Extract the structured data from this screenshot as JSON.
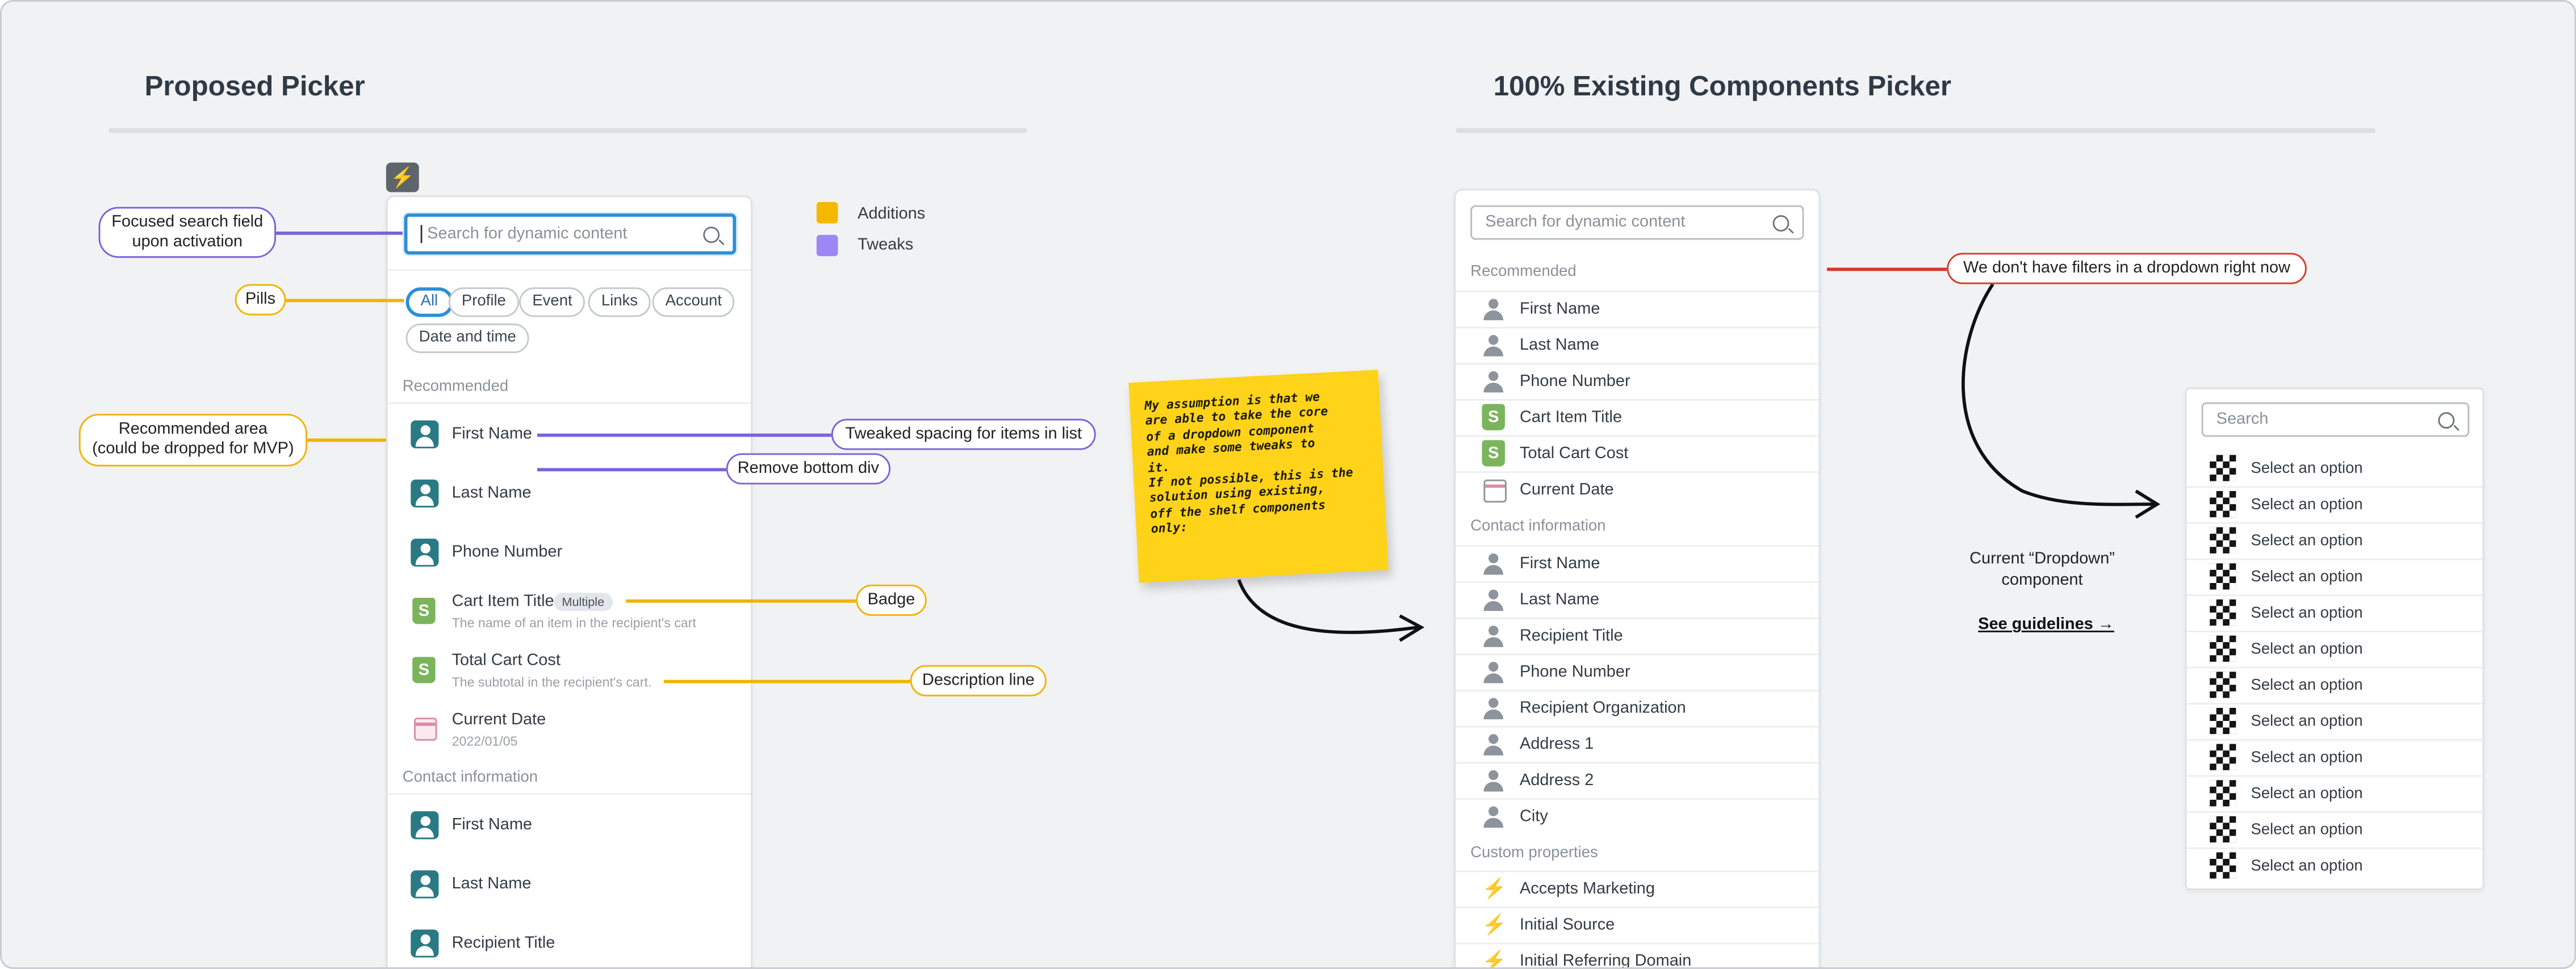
{
  "left_section": {
    "title": "Proposed Picker",
    "search_placeholder": "Search for dynamic content",
    "pills": [
      "All",
      "Profile",
      "Event",
      "Links",
      "Account",
      "Date and time"
    ],
    "groups": {
      "recommended": "Recommended",
      "contact": "Contact information"
    },
    "recommended_items": [
      {
        "label": "First Name",
        "icon": "person-avatar-icon"
      },
      {
        "label": "Last Name",
        "icon": "person-avatar-icon"
      },
      {
        "label": "Phone Number",
        "icon": "person-avatar-icon"
      },
      {
        "label": "Cart Item Title",
        "badge": "Multiple",
        "description": "The name of an item in the recipient's cart",
        "icon": "shopify-icon"
      },
      {
        "label": "Total Cart Cost",
        "description": "The subtotal in the recipient's cart.",
        "icon": "shopify-icon"
      },
      {
        "label": "Current Date",
        "description": "2022/01/05",
        "icon": "calendar-icon"
      }
    ],
    "contact_items": [
      {
        "label": "First Name"
      },
      {
        "label": "Last Name"
      },
      {
        "label": "Recipient Title"
      }
    ],
    "legend": {
      "additions": "Additions",
      "tweaks": "Tweaks",
      "additions_color": "#f5b800",
      "tweaks_color": "#9b87f5"
    },
    "callouts": {
      "focused_l1": "Focused search field",
      "focused_l2": "upon activation",
      "pills": "Pills",
      "recommended_l1": "Recommended area",
      "recommended_l2": "(could be dropped for MVP)",
      "spacing": "Tweaked spacing for items in list",
      "remove_div": "Remove bottom div",
      "badge": "Badge",
      "description": "Description line"
    }
  },
  "sticky_note": {
    "lines": [
      "My assumption is that we",
      "are able to take the core",
      "of a dropdown component",
      "and make some tweaks to",
      "it.",
      "If not possible, this is the",
      "solution using existing,",
      "off the shelf components",
      "only:"
    ]
  },
  "right_section": {
    "title": "100% Existing Components Picker",
    "search_placeholder": "Search for dynamic content",
    "groups": {
      "recommended": "Recommended",
      "contact": "Contact information",
      "custom": "Custom properties"
    },
    "recommended_items": [
      {
        "label": "First Name",
        "icon": "person-icon"
      },
      {
        "label": "Last Name",
        "icon": "person-icon"
      },
      {
        "label": "Phone Number",
        "icon": "person-icon"
      },
      {
        "label": "Cart Item Title",
        "icon": "shopify-icon"
      },
      {
        "label": "Total Cart Cost",
        "icon": "shopify-icon"
      },
      {
        "label": "Current Date",
        "icon": "calendar-icon"
      }
    ],
    "contact_items": [
      {
        "label": "First Name"
      },
      {
        "label": "Last Name"
      },
      {
        "label": "Recipient Title"
      },
      {
        "label": "Phone Number"
      },
      {
        "label": "Recipient Organization"
      },
      {
        "label": "Address 1"
      },
      {
        "label": "Address 2"
      },
      {
        "label": "City"
      }
    ],
    "custom_items": [
      {
        "label": "Accepts Marketing"
      },
      {
        "label": "Initial Source"
      },
      {
        "label": "Initial Referring Domain"
      }
    ],
    "filters_callout": "We don't have filters in a dropdown right now",
    "dropdown_note_l1": "Current “Dropdown”",
    "dropdown_note_l2": "component",
    "guidelines_link": "See guidelines →",
    "dropdown": {
      "search_placeholder": "Search",
      "options": [
        "Select an option",
        "Select an option",
        "Select an option",
        "Select an option",
        "Select an option",
        "Select an option",
        "Select an option",
        "Select an option",
        "Select an option",
        "Select an option",
        "Select an option",
        "Select an option"
      ]
    }
  }
}
